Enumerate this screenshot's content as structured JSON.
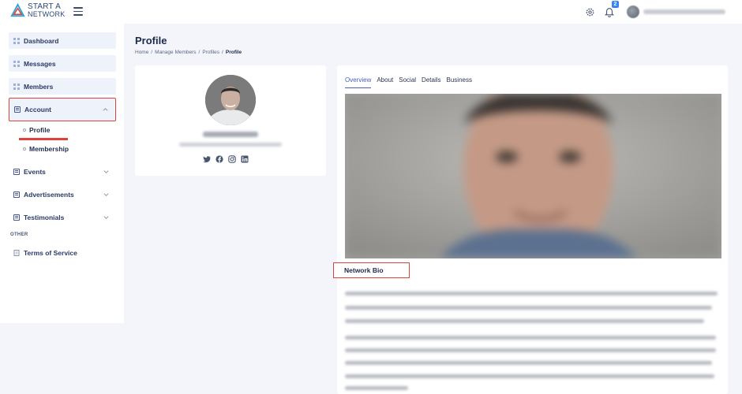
{
  "brand": {
    "line1": "START A",
    "line2": "NETWORK"
  },
  "topbar": {
    "notification_count": "2"
  },
  "sidebar": {
    "items": [
      {
        "label": "Dashboard"
      },
      {
        "label": "Messages"
      },
      {
        "label": "Members"
      },
      {
        "label": "Account"
      },
      {
        "label": "Events"
      },
      {
        "label": "Advertisements"
      },
      {
        "label": "Testimonials"
      }
    ],
    "account_sub": [
      {
        "label": "Profile"
      },
      {
        "label": "Membership"
      }
    ],
    "section_other": "OTHER",
    "terms": "Terms of Service"
  },
  "page": {
    "title": "Profile",
    "breadcrumb": [
      "Home",
      "Manage Members",
      "Profiles",
      "Profile"
    ]
  },
  "tabs": [
    "Overview",
    "About",
    "Social",
    "Details",
    "Business"
  ],
  "network_bio_heading": "Network Bio",
  "icons": {
    "socials": [
      "twitter-icon",
      "facebook-icon",
      "instagram-icon",
      "linkedin-icon"
    ]
  },
  "colors": {
    "highlight": "#e0413a",
    "accent": "#4b5fb3",
    "badge": "#3b82f6"
  }
}
